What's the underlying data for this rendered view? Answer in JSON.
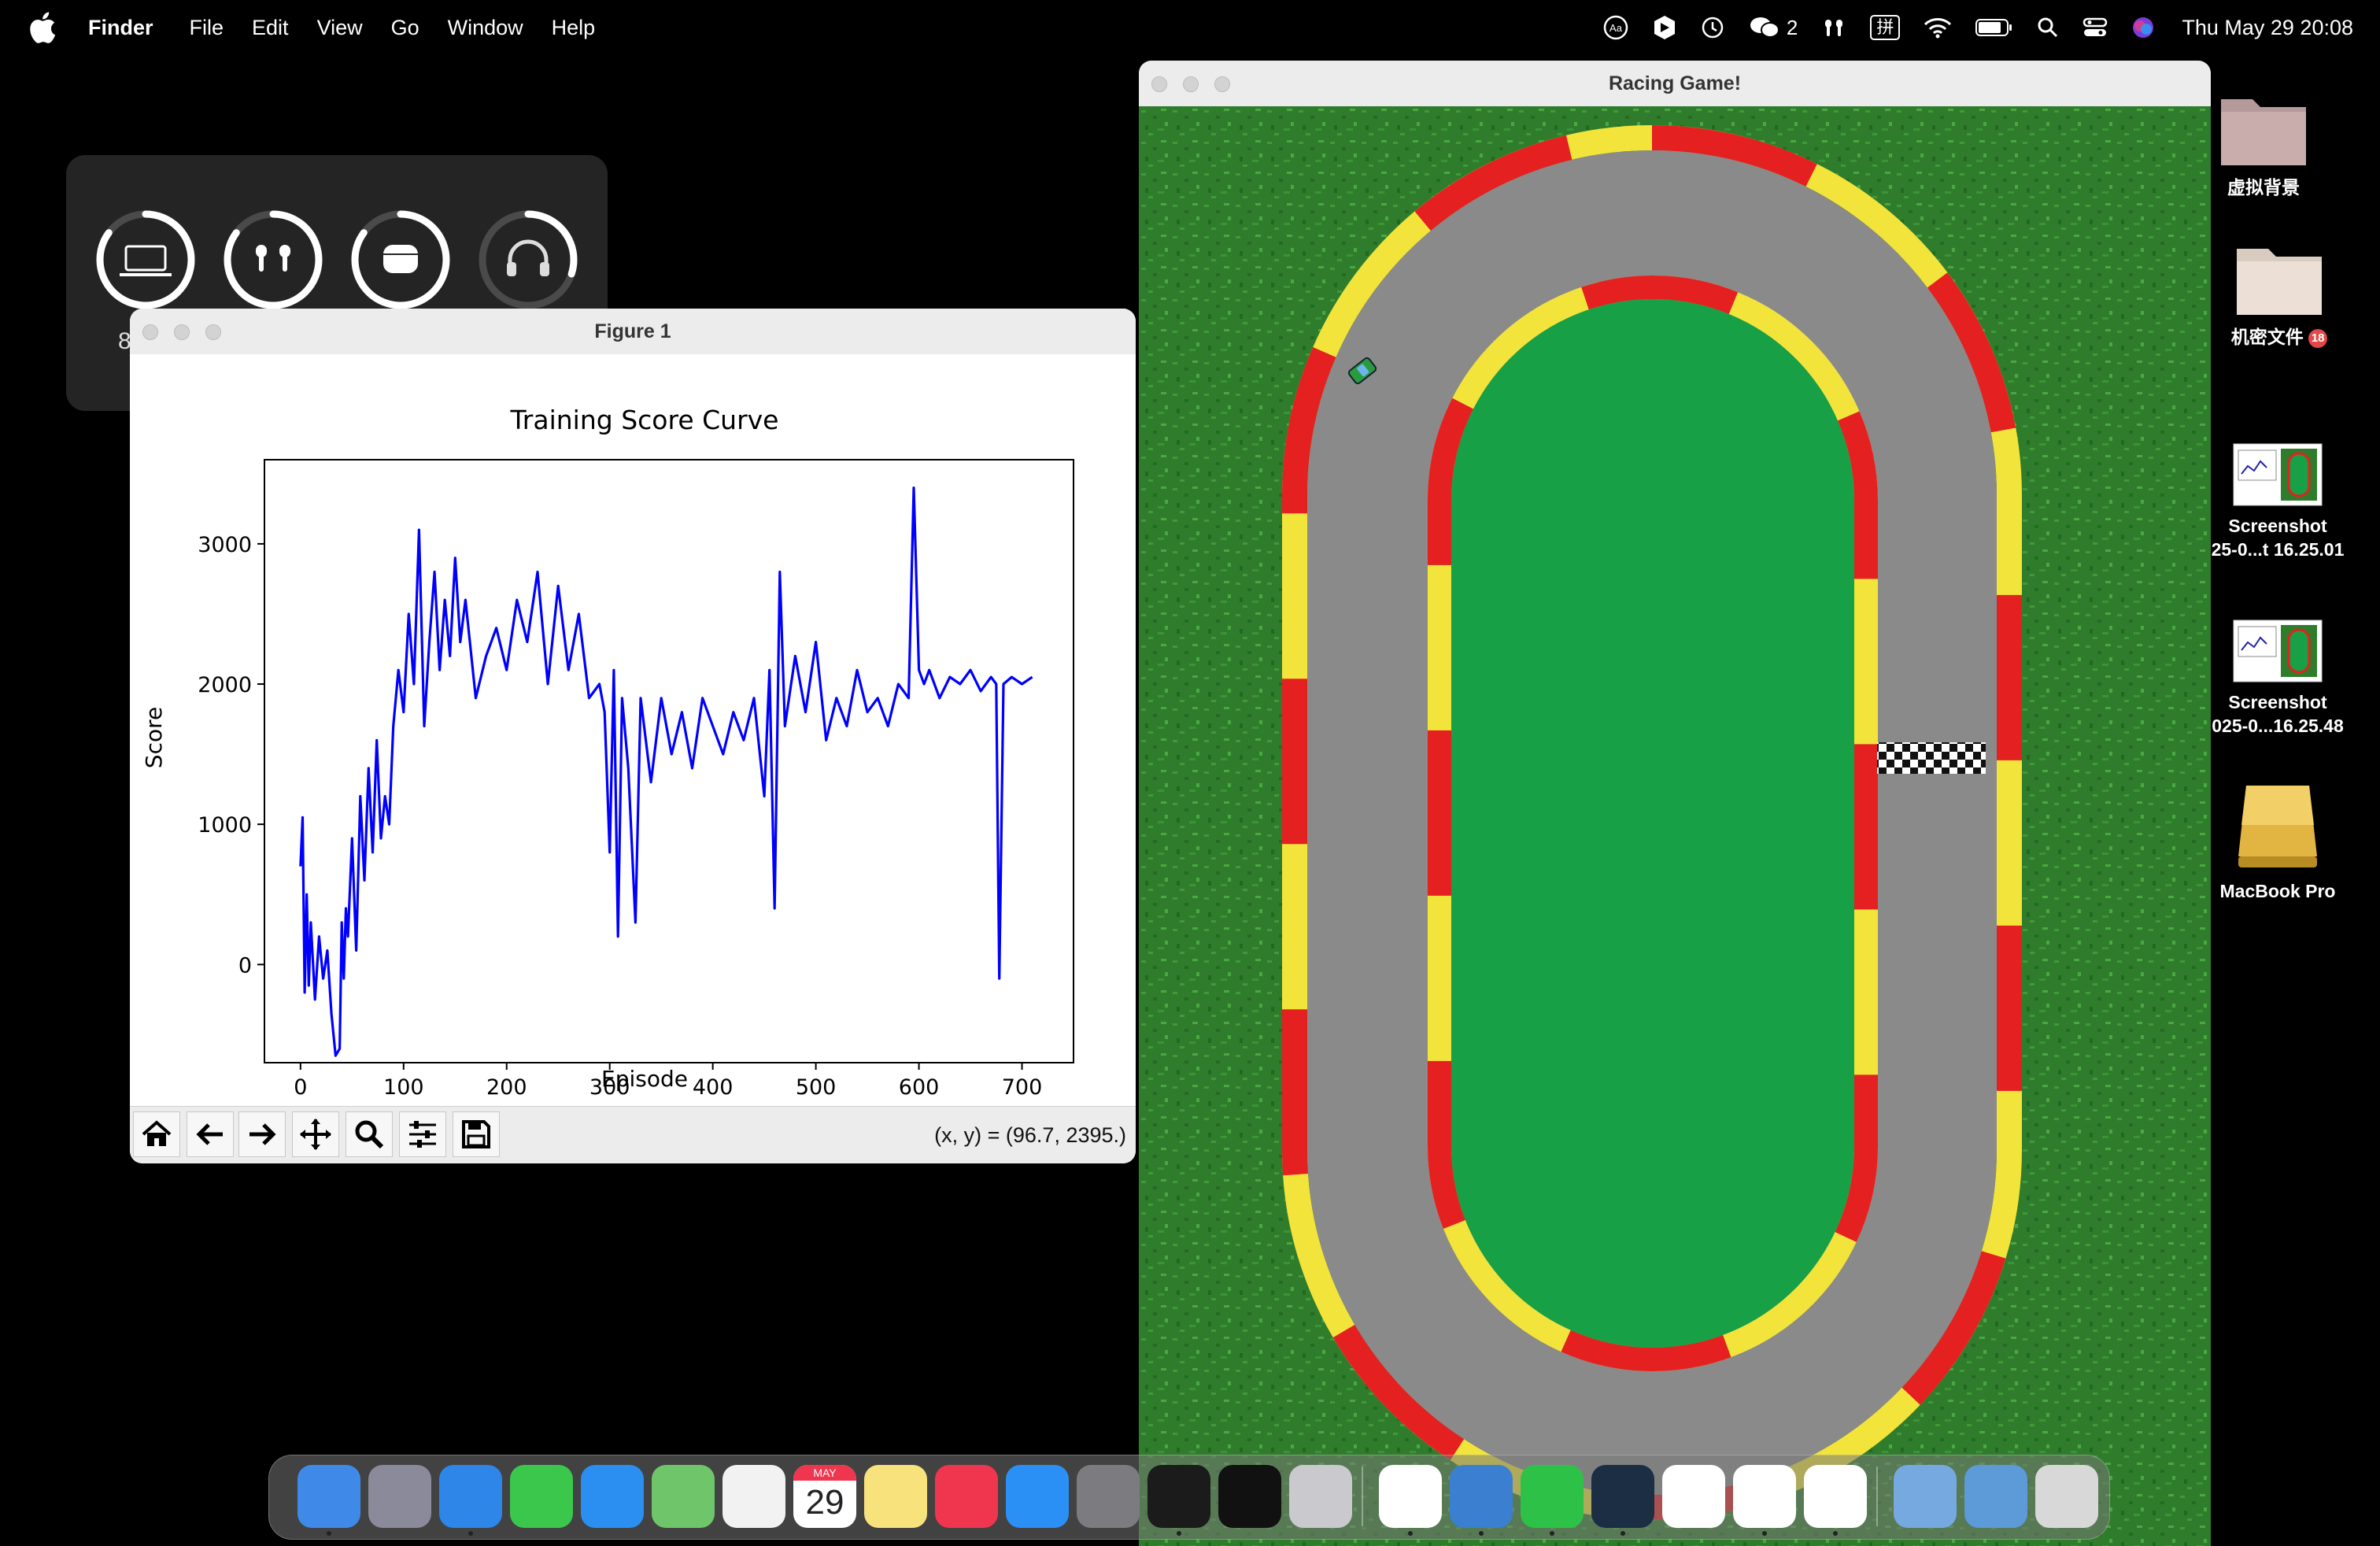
{
  "menubar": {
    "app_name": "Finder",
    "menus": [
      "File",
      "Edit",
      "View",
      "Go",
      "Window",
      "Help"
    ],
    "wechat_count": "2",
    "input_method": "拼",
    "clock": "Thu May 29  20:08"
  },
  "battery_widget": {
    "devices": [
      {
        "icon": "laptop-icon",
        "percent": "8",
        "level": 0.85
      },
      {
        "icon": "airpods-icon",
        "level": 0.85
      },
      {
        "icon": "airpods-case-icon",
        "level": 0.85
      },
      {
        "icon": "headphones-icon",
        "level": 0.3
      }
    ]
  },
  "figure_window": {
    "title": "Figure 1",
    "coordinate_readout": "(x, y) = (96.7, 2395.)",
    "toolbar": [
      "home-icon",
      "back-icon",
      "forward-icon",
      "pan-icon",
      "zoom-icon",
      "configure-icon",
      "save-icon"
    ]
  },
  "chart_data": {
    "type": "line",
    "title": "Training Score Curve",
    "xlabel": "Episode",
    "ylabel": "Score",
    "xlim": [
      -35,
      750
    ],
    "ylim": [
      -700,
      3600
    ],
    "xticks": [
      "0",
      "100",
      "200",
      "300",
      "400",
      "500",
      "600",
      "700"
    ],
    "yticks": [
      "0",
      "1000",
      "2000",
      "3000"
    ],
    "color": "#0000ff",
    "series": [
      {
        "x": [
          0,
          2,
          4,
          6,
          8,
          10,
          14,
          18,
          22,
          26,
          30,
          34,
          38,
          40,
          42,
          44,
          46,
          50,
          54,
          58,
          62,
          66,
          70,
          74,
          78,
          82,
          86,
          90,
          95,
          100,
          105,
          110,
          115,
          120,
          125,
          130,
          135,
          140,
          145,
          150,
          155,
          160,
          170,
          180,
          190,
          200,
          210,
          220,
          230,
          240,
          250,
          260,
          270,
          280,
          290,
          295,
          300,
          304,
          308,
          312,
          318,
          325,
          330,
          340,
          350,
          360,
          370,
          380,
          390,
          400,
          410,
          420,
          430,
          440,
          450,
          455,
          460,
          465,
          470,
          480,
          490,
          500,
          510,
          520,
          530,
          540,
          550,
          560,
          570,
          580,
          590,
          595,
          600,
          605,
          610,
          620,
          630,
          640,
          650,
          660,
          670,
          675,
          678,
          682,
          690,
          700,
          710
        ],
        "y": [
          700,
          1050,
          -200,
          500,
          -150,
          300,
          -250,
          200,
          -100,
          100,
          -350,
          -650,
          -600,
          300,
          -100,
          400,
          200,
          900,
          100,
          1200,
          600,
          1400,
          800,
          1600,
          900,
          1200,
          1000,
          1700,
          2100,
          1800,
          2500,
          2000,
          3100,
          1700,
          2300,
          2800,
          2100,
          2600,
          2200,
          2900,
          2300,
          2600,
          1900,
          2200,
          2400,
          2100,
          2600,
          2300,
          2800,
          2000,
          2700,
          2100,
          2500,
          1900,
          2000,
          1800,
          800,
          2100,
          200,
          1900,
          1400,
          300,
          1900,
          1300,
          1900,
          1500,
          1800,
          1400,
          1900,
          1700,
          1500,
          1800,
          1600,
          1900,
          1200,
          2100,
          400,
          2800,
          1700,
          2200,
          1800,
          2300,
          1600,
          1900,
          1700,
          2100,
          1800,
          1900,
          1700,
          2000,
          1900,
          3400,
          2100,
          2000,
          2100,
          1900,
          2050,
          2000,
          2100,
          1950,
          2050,
          2000,
          -100,
          2000,
          2050,
          2000,
          2050
        ]
      }
    ]
  },
  "racing_window": {
    "title": "Racing Game!"
  },
  "desktop_icons": [
    {
      "label": "虚拟背景",
      "icon": "folder-icon"
    },
    {
      "label": "机密文件",
      "badge": "18",
      "icon": "folder-icon"
    },
    {
      "label_line1": "Screenshot",
      "label_line2": "25-0...t 16.25.01",
      "icon": "screenshot-thumbnail-icon"
    },
    {
      "label_line1": "Screenshot",
      "label_line2": "025-0...16.25.48",
      "icon": "screenshot-thumbnail-icon"
    },
    {
      "label": "MacBook Pro",
      "icon": "drive-icon"
    }
  ],
  "dock": {
    "calendar_month": "MAY",
    "calendar_day": "29",
    "apps": [
      "finder",
      "launchpad",
      "safari",
      "messages",
      "mail",
      "maps",
      "photos",
      "calendar",
      "notes",
      "music",
      "app-store",
      "system-settings",
      "terminal",
      "activity-monitor",
      "iphone-mirroring",
      "chrome",
      "dictionary",
      "wechat",
      "cursor",
      "mongodb-compass",
      "vscode",
      "pinwheel",
      "folder",
      "downloads",
      "trash"
    ],
    "colors": {
      "finder": "#3f8ae8",
      "launchpad": "#8a8a9a",
      "safari": "#2d86e8",
      "messages": "#3ac74c",
      "mail": "#2a8ff0",
      "maps": "#6fc56a",
      "photos": "#f2f2f2",
      "calendar": "#ffffff",
      "notes": "#f8e27b",
      "music": "#f0364e",
      "app-store": "#2a90f5",
      "system-settings": "#7b7b80",
      "terminal": "#1b1b1b",
      "activity-monitor": "#111111",
      "iphone-mirroring": "#c9c9ce",
      "chrome": "#ffffff",
      "dictionary": "#3a7fd0",
      "wechat": "#2dc247",
      "cursor": "#1b2e44",
      "mongodb-compass": "#ffffff",
      "vscode": "#ffffff",
      "pinwheel": "#ffffff",
      "folder": "#76a9df",
      "downloads": "#5c9ad8",
      "trash": "#d8d8d8"
    }
  }
}
